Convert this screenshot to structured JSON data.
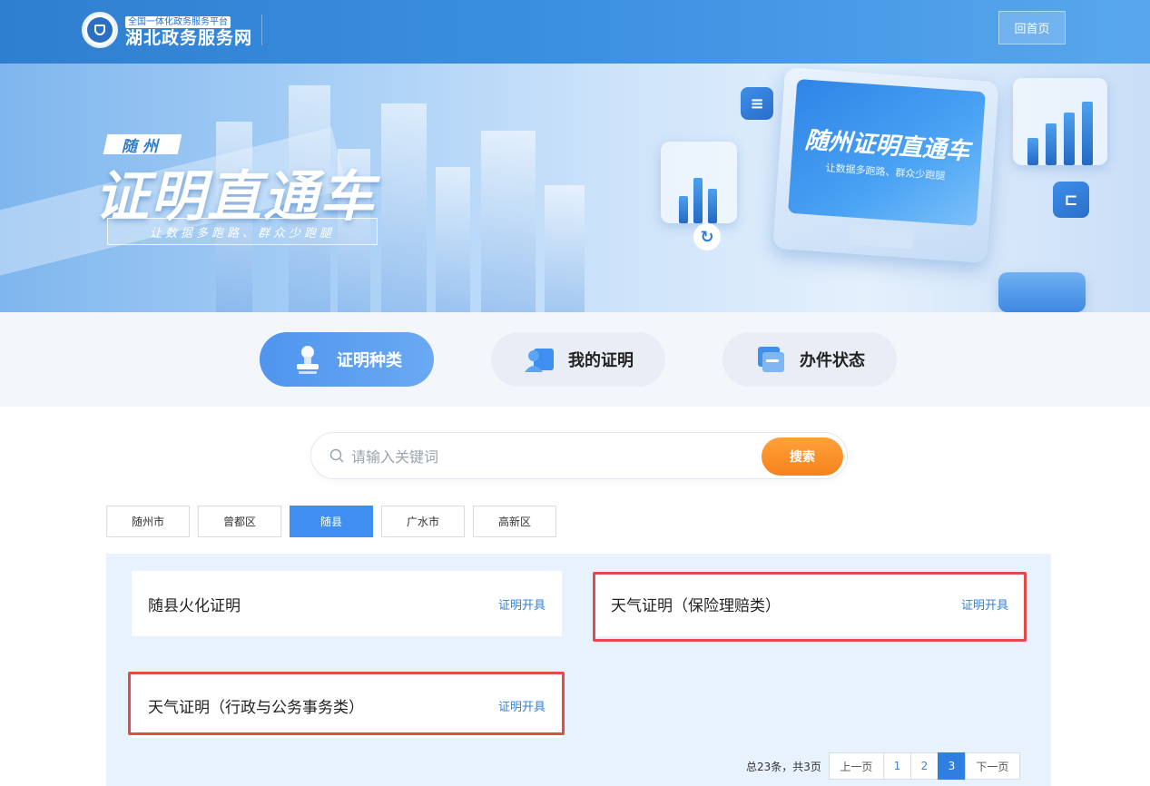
{
  "header": {
    "platform_label": "全国一体化政务服务平台",
    "site_name": "湖北政务服务网",
    "home_button": "回首页"
  },
  "banner": {
    "city_tag": "随州",
    "title": "证明直通车",
    "slogan": "让数据多跑路、群众少跑腿",
    "screen_title": "随州证明直通车",
    "screen_slogan": "让数据多跑路、群众少跑腿"
  },
  "tabs": [
    {
      "label": "证明种类",
      "active": true
    },
    {
      "label": "我的证明",
      "active": false
    },
    {
      "label": "办件状态",
      "active": false
    }
  ],
  "search": {
    "placeholder": "请输入关键词",
    "value": "",
    "button_label": "搜索"
  },
  "districts": [
    {
      "label": "随州市",
      "active": false
    },
    {
      "label": "曾都区",
      "active": false
    },
    {
      "label": "随县",
      "active": true
    },
    {
      "label": "广水市",
      "active": false
    },
    {
      "label": "高新区",
      "active": false
    }
  ],
  "results": [
    {
      "title": "随县火化证明",
      "action": "证明开具",
      "highlighted": false
    },
    {
      "title": "天气证明（保险理赔类）",
      "action": "证明开具",
      "highlighted": true
    },
    {
      "title": "天气证明（行政与公务事务类）",
      "action": "证明开具",
      "highlighted": true
    }
  ],
  "pagination": {
    "total_text": "总23条，共3页",
    "prev_label": "上一页",
    "next_label": "下一页",
    "pages": [
      "1",
      "2",
      "3"
    ],
    "current_page": "3"
  },
  "colors": {
    "brand_blue": "#2f7fd0",
    "active_blue": "#3f8ff0",
    "search_orange": "#f6821c",
    "highlight_red": "#e24b4b",
    "results_bg": "#e8f2fd"
  }
}
